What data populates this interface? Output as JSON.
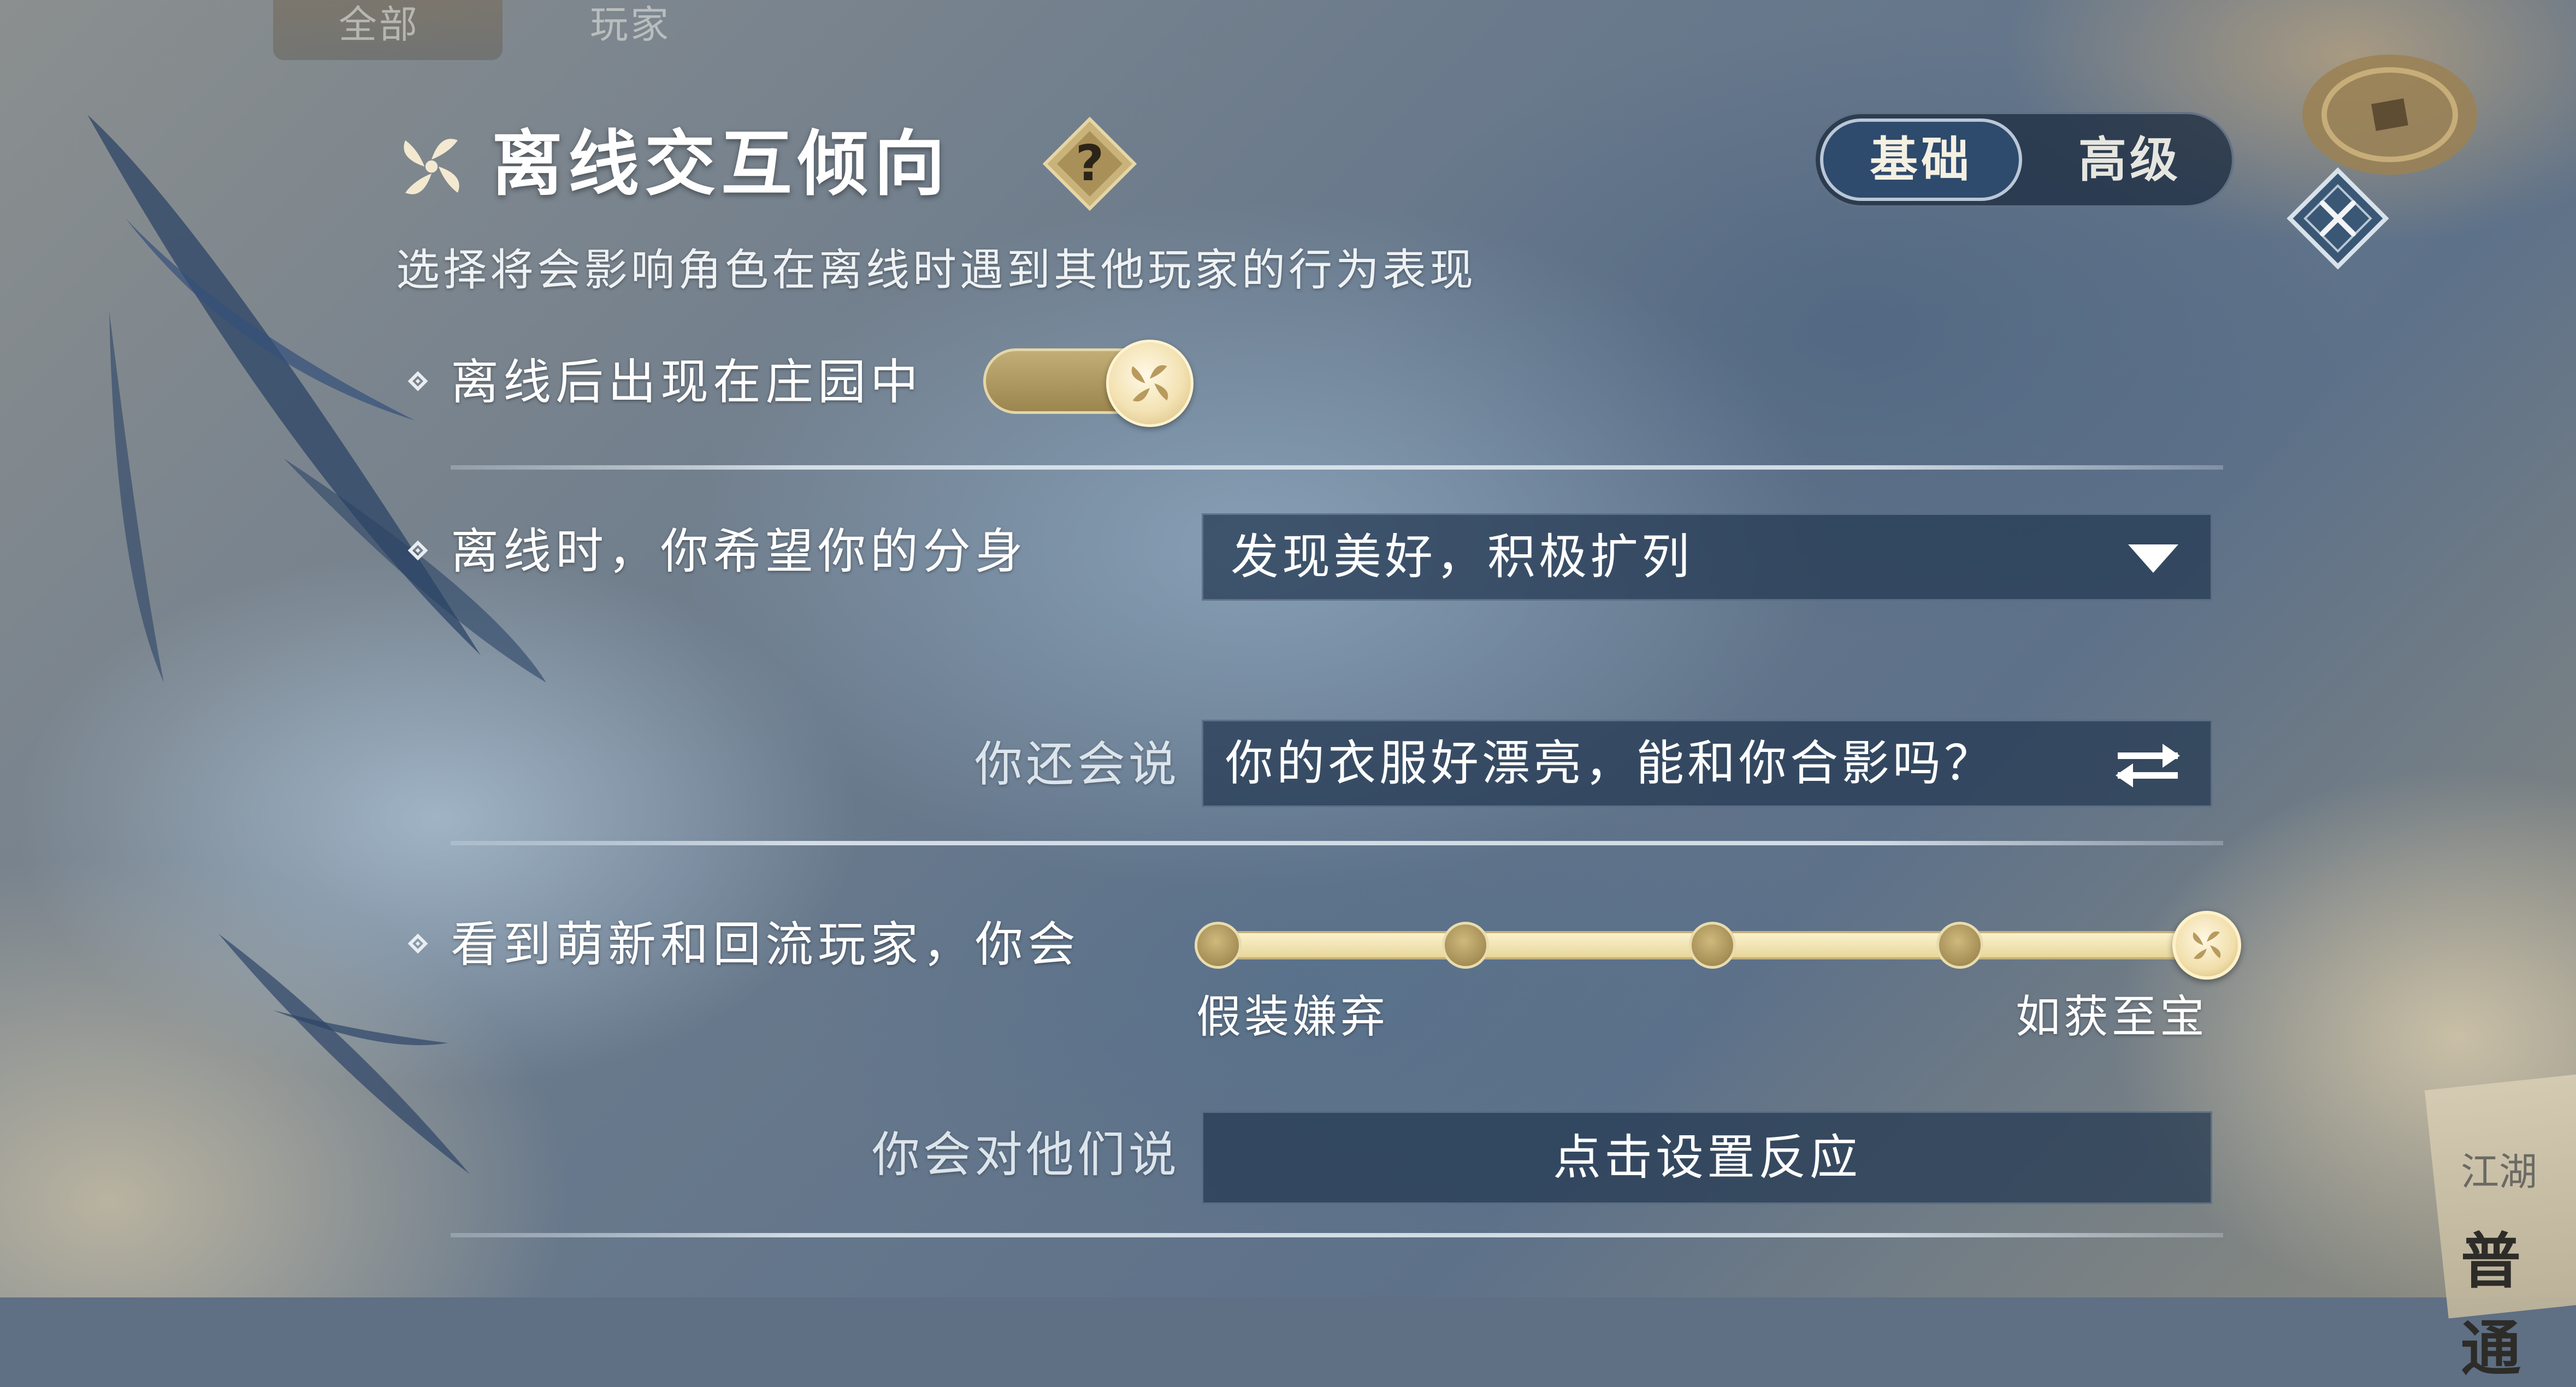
{
  "top_tabs": [
    "全部",
    "玩家"
  ],
  "panel": {
    "title": "离线交互倾向",
    "help_icon_text": "?",
    "subtitle": "选择将会影响角色在离线时遇到其他玩家的行为表现",
    "mode_switch": {
      "basic": "基础",
      "advanced": "高级",
      "selected": "基础"
    }
  },
  "rows": {
    "appear_in_manor": {
      "label": "离线后出现在庄园中",
      "enabled": true
    },
    "clone_behavior": {
      "label": "离线时，你希望你的分身",
      "selected": "发现美好，积极扩列"
    },
    "also_say": {
      "label": "你还会说",
      "value": "你的衣服好漂亮，能和你合影吗？"
    },
    "newcomer_attitude": {
      "label": "看到萌新和回流玩家，你会",
      "min_label": "假装嫌弃",
      "max_label": "如获至宝",
      "steps": 5,
      "value": 5
    },
    "say_to_them": {
      "label": "你会对他们说",
      "button": "点击设置反应"
    }
  },
  "side_card": {
    "line1": "江湖",
    "line2": "普通"
  },
  "colors": {
    "gold": "#c9b37a",
    "panel_dark": "#233750",
    "accent_light": "#f4f0e2"
  },
  "icons": [
    "pinwheel-icon",
    "help-icon",
    "close-icon",
    "dropdown-arrow-icon",
    "swap-icon",
    "coin-icon"
  ]
}
